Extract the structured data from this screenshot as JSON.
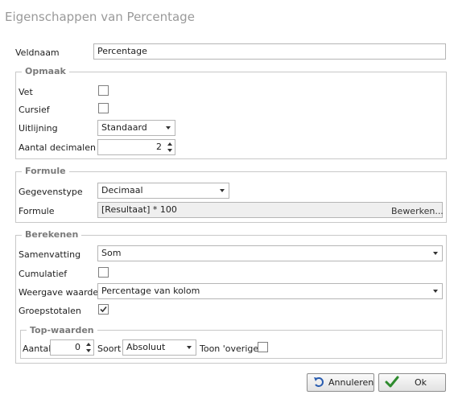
{
  "dialog": {
    "title": "Eigenschappen van Percentage"
  },
  "veldnaam": {
    "label": "Veldnaam",
    "value": "Percentage"
  },
  "opmaak": {
    "title": "Opmaak",
    "vet_label": "Vet",
    "vet_checked": false,
    "cursief_label": "Cursief",
    "cursief_checked": false,
    "uitlijning_label": "Uitlijning",
    "uitlijning_value": "Standaard",
    "decimalen_label": "Aantal decimalen",
    "decimalen_value": "2"
  },
  "formule": {
    "title": "Formule",
    "type_label": "Gegevenstype",
    "type_value": "Decimaal",
    "formule_label": "Formule",
    "formule_value": "[Resultaat] * 100",
    "bewerken_label": "Bewerken..."
  },
  "berekenen": {
    "title": "Berekenen",
    "samenvatting_label": "Samenvatting",
    "samenvatting_value": "Som",
    "cumulatief_label": "Cumulatief",
    "cumulatief_checked": false,
    "weergave_label": "Weergave waardes",
    "weergave_value": "Percentage van kolom",
    "groepstotalen_label": "Groepstotalen",
    "groepstotalen_checked": true,
    "top": {
      "title": "Top-waarden",
      "aantal_label": "Aantal",
      "aantal_value": "0",
      "soort_label": "Soort",
      "soort_value": "Absoluut",
      "overige_label": "Toon 'overige'",
      "overige_checked": false
    }
  },
  "buttons": {
    "cancel_label": "Annuleren",
    "ok_label": "Ok"
  },
  "icons": {
    "cancel": "undo-arrow-icon",
    "ok": "checkmark-icon",
    "check": "checkmark-icon"
  }
}
